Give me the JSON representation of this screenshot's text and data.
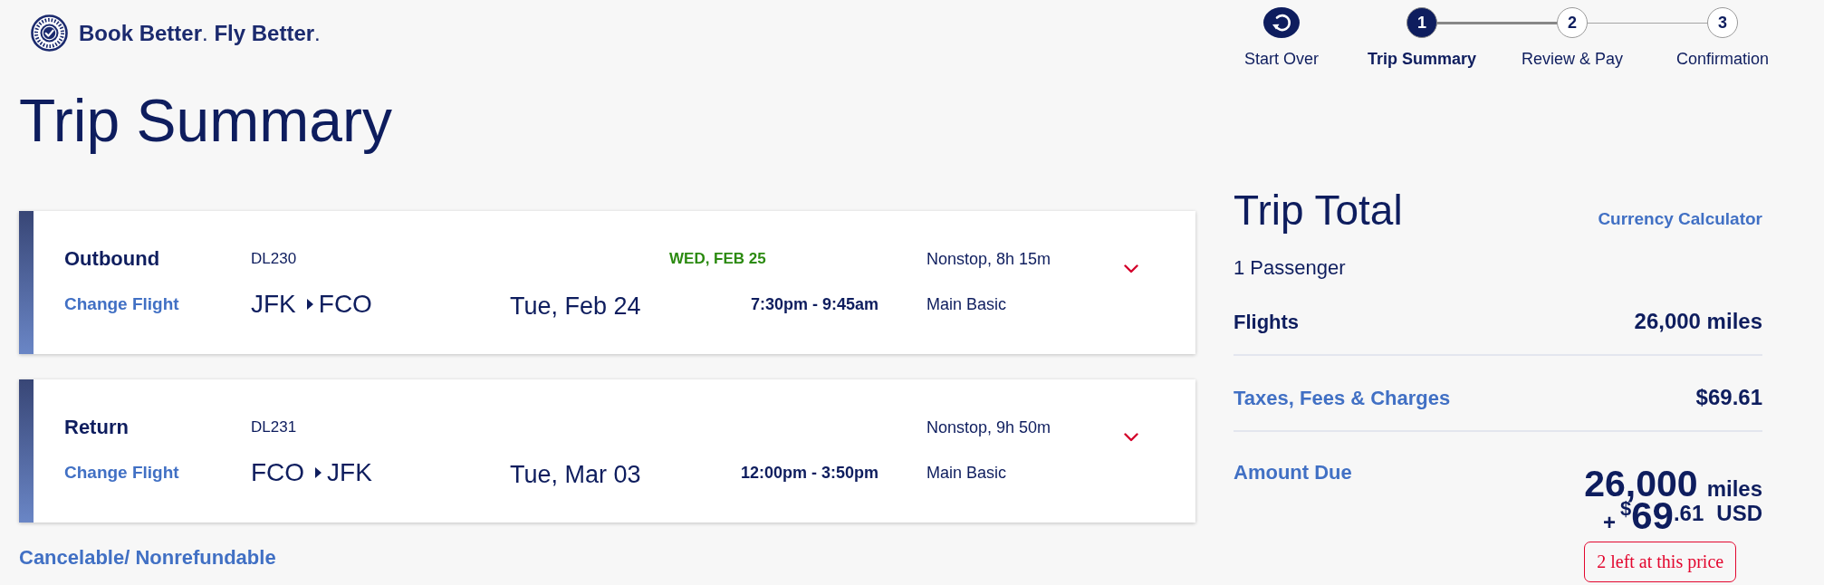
{
  "header": {
    "logo_text": "**Book Better**. **Fly Better**."
  },
  "start_over": {
    "label": "Start Over"
  },
  "steps": [
    {
      "number": "1",
      "label": "Trip Summary",
      "selected": true
    },
    {
      "number": "2",
      "label": "Review & Pay",
      "selected": false
    },
    {
      "number": "3",
      "label": "Confirmation",
      "selected": false
    }
  ],
  "page_title": "Trip Summary",
  "flights": [
    {
      "direction": "Outbound",
      "action": "Change Flight",
      "flight_number": "DL230",
      "origin": "JFK",
      "destination": "FCO",
      "date": "Tue, Feb 24",
      "arrival_note": "WED, FEB 25",
      "times": "7:30pm - 9:45am",
      "duration": "Nonstop, 8h 15m",
      "fare_class": "Main Basic",
      "expanded": false
    },
    {
      "direction": "Return",
      "action": "Change Flight",
      "flight_number": "DL231",
      "origin": "FCO",
      "destination": "JFK",
      "date": "Tue, Mar 03",
      "times": "12:00pm - 3:50pm",
      "duration": "Nonstop, 9h 50m",
      "fare_class": "Main Basic",
      "expanded": false
    }
  ],
  "fare_rules_link": "Cancelable/ Nonrefundable",
  "trip_total": {
    "title": "Trip Total",
    "link": "Currency Calculator",
    "passengers": "1 Passenger",
    "lines": [
      {
        "label": "Flights",
        "value": "26,000 miles",
        "kind": "text"
      },
      {
        "label": "Taxes, Fees & Charges",
        "value": "$69.61",
        "kind": "link"
      }
    ],
    "amount_due": {
      "label": "Amount Due",
      "miles": "26,000",
      "miles_unit": "miles",
      "plus": "+",
      "currency_symbol": "$",
      "dollars": "69",
      "cents": ".61",
      "currency": "USD"
    },
    "availability": "2 left at this price"
  }
}
